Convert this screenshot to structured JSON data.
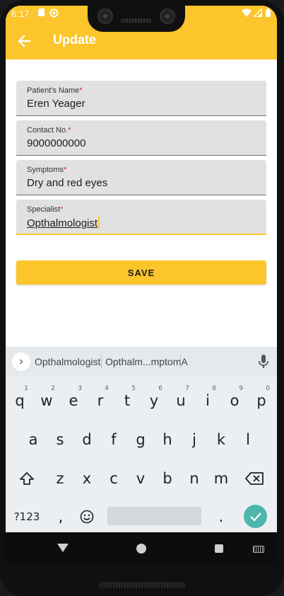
{
  "status_bar": {
    "time": "6:17"
  },
  "app_bar": {
    "title": "Update"
  },
  "form": {
    "fields": [
      {
        "label": "Patient's Name",
        "required_mark": "*",
        "value": "Eren Yeager"
      },
      {
        "label": "Contact No.",
        "required_mark": "*",
        "value": "9000000000"
      },
      {
        "label": "Symptoms",
        "required_mark": "*",
        "value": "Dry and red eyes"
      },
      {
        "label": "Specialist",
        "required_mark": "*",
        "value": "Opthalmologist"
      }
    ],
    "save_label": "SAVE"
  },
  "keyboard": {
    "suggestions": [
      "Opthalmologist",
      "Opthalm...mptomA"
    ],
    "row1": [
      {
        "key": "q",
        "hint": "1"
      },
      {
        "key": "w",
        "hint": "2"
      },
      {
        "key": "e",
        "hint": "3"
      },
      {
        "key": "r",
        "hint": "4"
      },
      {
        "key": "t",
        "hint": "5"
      },
      {
        "key": "y",
        "hint": "6"
      },
      {
        "key": "u",
        "hint": "7"
      },
      {
        "key": "i",
        "hint": "8"
      },
      {
        "key": "o",
        "hint": "9"
      },
      {
        "key": "p",
        "hint": "0"
      }
    ],
    "row2": [
      "a",
      "s",
      "d",
      "f",
      "g",
      "h",
      "j",
      "k",
      "l"
    ],
    "row3": [
      "z",
      "x",
      "c",
      "v",
      "b",
      "n",
      "m"
    ],
    "symbols_label": "?123",
    "comma": ",",
    "period": "."
  },
  "colors": {
    "accent": "#fbc52b",
    "required": "#e0281f",
    "enter": "#4db6ac"
  },
  "icons": [
    "back-arrow-icon",
    "sim-icon",
    "sync-icon",
    "wifi-icon",
    "signal-icon",
    "battery-icon",
    "chevron-right-icon",
    "mic-icon",
    "shift-icon",
    "backspace-icon",
    "emoji-icon",
    "checkmark-icon"
  ]
}
